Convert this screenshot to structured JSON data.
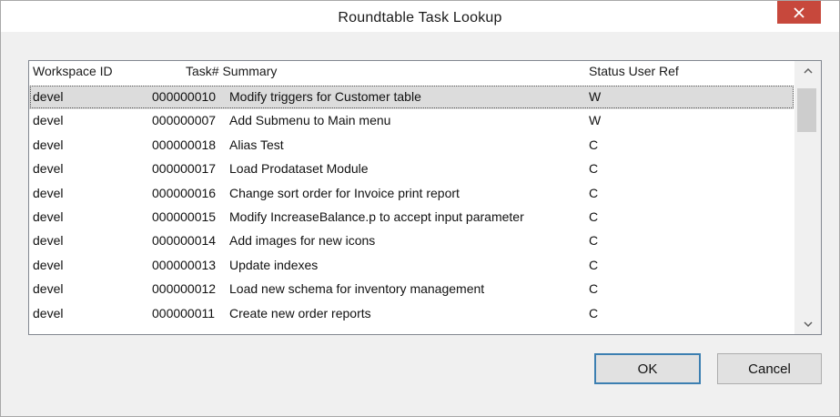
{
  "window": {
    "title": "Roundtable Task Lookup"
  },
  "list": {
    "headers": {
      "workspace_id": "Workspace ID",
      "task_summary": "Task# Summary",
      "status": "Status User Ref"
    },
    "rows": [
      {
        "workspace": "devel",
        "task": "000000010",
        "summary": "Modify triggers for Customer table",
        "status": "W",
        "selected": true
      },
      {
        "workspace": "devel",
        "task": "000000007",
        "summary": "Add Submenu to Main menu",
        "status": "W"
      },
      {
        "workspace": "devel",
        "task": "000000018",
        "summary": "Alias Test",
        "status": "C"
      },
      {
        "workspace": "devel",
        "task": "000000017",
        "summary": "Load Prodataset Module",
        "status": "C"
      },
      {
        "workspace": "devel",
        "task": "000000016",
        "summary": "Change sort order for Invoice print report",
        "status": "C"
      },
      {
        "workspace": "devel",
        "task": "000000015",
        "summary": "Modify IncreaseBalance.p to accept input parameter",
        "status": "C"
      },
      {
        "workspace": "devel",
        "task": "000000014",
        "summary": "Add images for new icons",
        "status": "C"
      },
      {
        "workspace": "devel",
        "task": "000000013",
        "summary": "Update indexes",
        "status": "C"
      },
      {
        "workspace": "devel",
        "task": "000000012",
        "summary": "Load new schema for inventory management",
        "status": "C"
      },
      {
        "workspace": "devel",
        "task": "000000011",
        "summary": "Create new order reports",
        "status": "C"
      }
    ]
  },
  "buttons": {
    "ok": "OK",
    "cancel": "Cancel"
  },
  "icons": {
    "close": "close-icon",
    "scroll_up": "chevron-up-icon",
    "scroll_down": "chevron-down-icon"
  },
  "colors": {
    "close_button": "#c7483c",
    "selection": "#dcdcdc",
    "default_button_border": "#3c7fb1"
  }
}
